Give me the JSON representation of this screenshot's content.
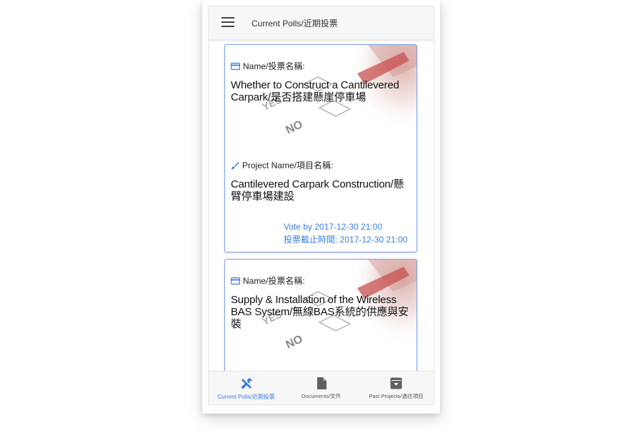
{
  "appbar": {
    "menu_icon": "hamburger-menu-icon",
    "title": "Current Polls/近期投票"
  },
  "polls": [
    {
      "name_label": "Name/投票名稱:",
      "name_icon": "credit-card-icon",
      "title": "Whether to Construct a Cantilevered Carpark/是否搭建懸崖停車場",
      "project_label": "Project Name/項目名稱:",
      "project_icon": "brush-icon",
      "project_name": "Cantilevered Carpark Construction/懸臂停車場建設",
      "deadline_en": "Vote by 2017-12-30 21:00",
      "deadline_zh": "投票截止時間: 2017-12-30 21:00"
    },
    {
      "name_label": "Name/投票名稱:",
      "name_icon": "credit-card-icon",
      "title": "Supply & Installation of the Wireless BAS System/無線BAS系統的供應與安裝"
    }
  ],
  "ballot_image": {
    "yes": "YES",
    "no": "NO"
  },
  "bottom_nav": [
    {
      "label": "Current Polls/近期投票",
      "icon": "tools-icon",
      "active": true
    },
    {
      "label": "Documents/文件",
      "icon": "document-icon",
      "active": false
    },
    {
      "label": "Past Projects/過往項目",
      "icon": "archive-icon",
      "active": false
    }
  ],
  "colors": {
    "accent": "#3b7fe0",
    "card_border": "#7aa3e8",
    "appbar_bg": "#f7f7f7"
  }
}
